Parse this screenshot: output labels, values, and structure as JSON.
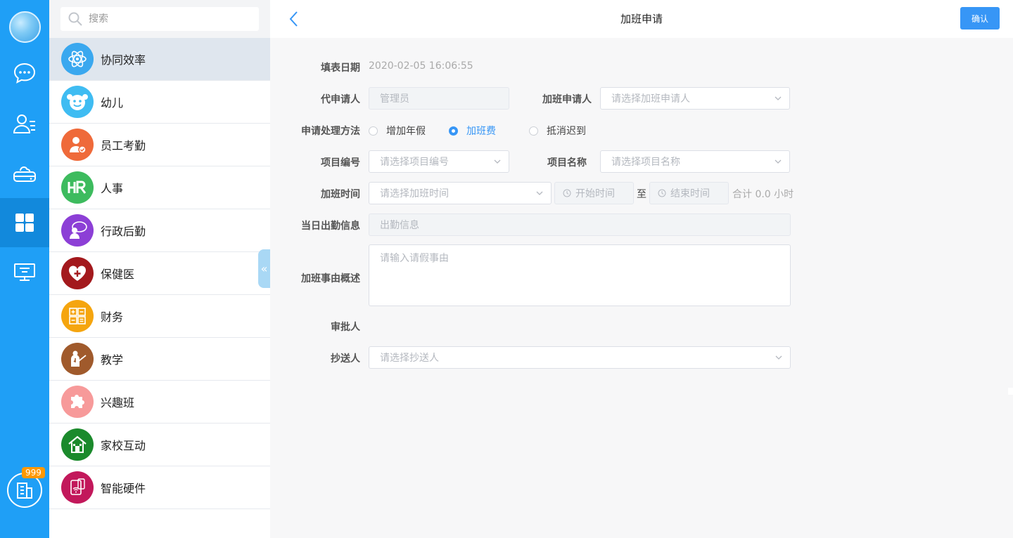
{
  "colors": {
    "rail": "#1f9ff6",
    "rail_active": "#1289dc",
    "accent": "#3796f6",
    "badge": "#ff9800"
  },
  "rail": {
    "items": [
      {
        "icon": "chat-icon"
      },
      {
        "icon": "contacts-icon"
      },
      {
        "icon": "cloud-drive-icon"
      },
      {
        "icon": "apps-grid-icon",
        "active": true
      },
      {
        "icon": "monitor-icon"
      }
    ],
    "bottom": {
      "icon": "building-icon",
      "badge": "999"
    }
  },
  "search": {
    "placeholder": "搜索"
  },
  "menu": {
    "items": [
      {
        "label": "协同效率",
        "icon": "atom-icon",
        "color": "#3aa8ef",
        "active": true
      },
      {
        "label": "幼儿",
        "icon": "smiley-face-icon",
        "color": "#3fbcf2"
      },
      {
        "label": "员工考勤",
        "icon": "employee-check-icon",
        "color": "#ef6a3a"
      },
      {
        "label": "人事",
        "icon": "hr-icon",
        "color": "#3dbb5e"
      },
      {
        "label": "行政后勤",
        "icon": "admin-person-icon",
        "color": "#8c3fd6"
      },
      {
        "label": "保健医",
        "icon": "heart-plus-icon",
        "color": "#a3191d"
      },
      {
        "label": "财务",
        "icon": "calculator-icon",
        "color": "#f5a50f"
      },
      {
        "label": "教学",
        "icon": "teacher-icon",
        "color": "#a05a2c"
      },
      {
        "label": "兴趣班",
        "icon": "puzzle-icon",
        "color": "#f79a9a"
      },
      {
        "label": "家校互动",
        "icon": "house-icon",
        "color": "#1b8a2c"
      },
      {
        "label": "智能硬件",
        "icon": "smart-device-icon",
        "color": "#c2185b"
      }
    ]
  },
  "header": {
    "title": "加班申请",
    "confirm_label": "确认"
  },
  "form": {
    "fill_date": {
      "label": "填表日期",
      "value": "2020-02-05 16:06:55"
    },
    "proxy_applicant": {
      "label": "代申请人",
      "value": "管理员"
    },
    "applicant": {
      "label": "加班申请人",
      "placeholder": "请选择加班申请人"
    },
    "method": {
      "label": "申请处理方法",
      "options": [
        "增加年假",
        "加班费",
        "抵消迟到"
      ],
      "selected": "加班费"
    },
    "project_no": {
      "label": "项目编号",
      "placeholder": "请选择项目编号"
    },
    "project_name": {
      "label": "项目名称",
      "placeholder": "请选择项目名称"
    },
    "ot_time": {
      "label": "加班时间",
      "placeholder": "请选择加班时间",
      "start_placeholder": "开始时间",
      "separator": "至",
      "end_placeholder": "结束时间",
      "total": "合计 0.0 小时"
    },
    "attendance": {
      "label": "当日出勤信息",
      "placeholder": "出勤信息"
    },
    "reason": {
      "label": "加班事由概述",
      "placeholder": "请输入请假事由"
    },
    "approver": {
      "label": "审批人"
    },
    "cc": {
      "label": "抄送人",
      "placeholder": "请选择抄送人"
    }
  }
}
